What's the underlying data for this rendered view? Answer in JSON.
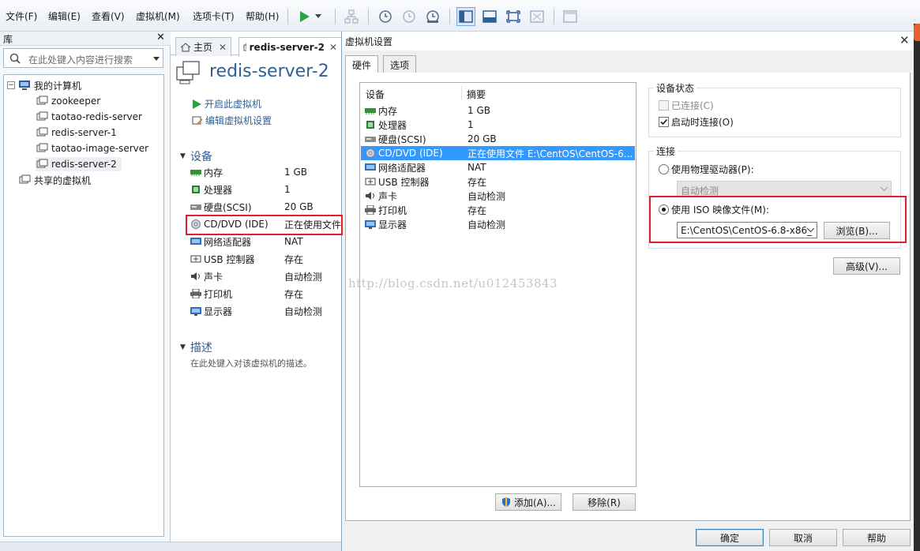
{
  "menu": [
    "文件(F)",
    "编辑(E)",
    "查看(V)",
    "虚拟机(M)",
    "选项卡(T)",
    "帮助(H)"
  ],
  "library": {
    "title": "库",
    "search_placeholder": "在此处键入内容进行搜索",
    "tree": {
      "root": "我的计算机",
      "vms": [
        "zookeeper",
        "taotao-redis-server",
        "redis-server-1",
        "taotao-image-server",
        "redis-server-2"
      ],
      "shared": "共享的虚拟机"
    }
  },
  "tabs": [
    {
      "label": "主页"
    },
    {
      "label": "redis-server-2"
    }
  ],
  "vm": {
    "name": "redis-server-2",
    "actions": [
      "开启此虚拟机",
      "编辑虚拟机设置"
    ],
    "devices_title": "设备",
    "devices": [
      {
        "name": "内存",
        "value": "1 GB",
        "icon": "memory-icon"
      },
      {
        "name": "处理器",
        "value": "1",
        "icon": "cpu-icon"
      },
      {
        "name": "硬盘(SCSI)",
        "value": "20 GB",
        "icon": "hdd-icon"
      },
      {
        "name": "CD/DVD (IDE)",
        "value": "正在使用文件",
        "icon": "cdrom-icon"
      },
      {
        "name": "网络适配器",
        "value": "NAT",
        "icon": "network-icon"
      },
      {
        "name": "USB 控制器",
        "value": "存在",
        "icon": "usb-icon"
      },
      {
        "name": "声卡",
        "value": "自动检测",
        "icon": "sound-icon"
      },
      {
        "name": "打印机",
        "value": "存在",
        "icon": "printer-icon"
      },
      {
        "name": "显示器",
        "value": "自动检测",
        "icon": "display-icon"
      }
    ],
    "desc_title": "描述",
    "desc_placeholder": "在此处键入对该虚拟机的描述。"
  },
  "dialog": {
    "title": "虚拟机设置",
    "tabs": [
      "硬件",
      "选项"
    ],
    "list_headers": [
      "设备",
      "摘要"
    ],
    "devices": [
      {
        "name": "内存",
        "summary": "1 GB",
        "icon": "memory-icon"
      },
      {
        "name": "处理器",
        "summary": "1",
        "icon": "cpu-icon"
      },
      {
        "name": "硬盘(SCSI)",
        "summary": "20 GB",
        "icon": "hdd-icon"
      },
      {
        "name": "CD/DVD (IDE)",
        "summary": "正在使用文件 E:\\CentOS\\CentOS-6...",
        "icon": "cdrom-icon"
      },
      {
        "name": "网络适配器",
        "summary": "NAT",
        "icon": "network-icon"
      },
      {
        "name": "USB 控制器",
        "summary": "存在",
        "icon": "usb-icon"
      },
      {
        "name": "声卡",
        "summary": "自动检测",
        "icon": "sound-icon"
      },
      {
        "name": "打印机",
        "summary": "存在",
        "icon": "printer-icon"
      },
      {
        "name": "显示器",
        "summary": "自动检测",
        "icon": "display-icon"
      }
    ],
    "selected_index": 3,
    "add_button": "添加(A)...",
    "remove_button": "移除(R)",
    "device_status": {
      "title": "设备状态",
      "connected": "已连接(C)",
      "connect_at_power_on": "启动时连接(O)"
    },
    "connection": {
      "title": "连接",
      "physical_drive": "使用物理驱动器(P):",
      "physical_drive_value": "自动检测",
      "iso_label": "使用 ISO 映像文件(M):",
      "iso_path": "E:\\CentOS\\CentOS-6.8-x86_",
      "browse_button": "浏览(B)..."
    },
    "advanced_button": "高级(V)...",
    "ok_button": "确定",
    "cancel_button": "取消",
    "help_button": "帮助"
  },
  "watermark": "http://blog.csdn.net/u012453843",
  "colors": {
    "accent": "#2f5f97",
    "selection": "#3399ff",
    "highlight_box": "#e0202a"
  }
}
